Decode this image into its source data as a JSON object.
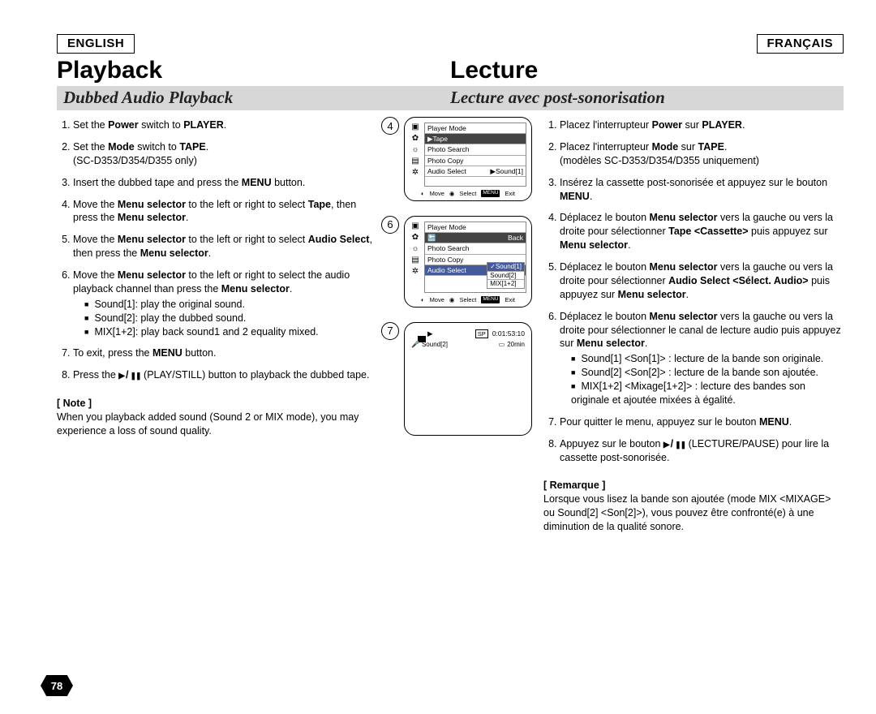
{
  "lang_left": "ENGLISH",
  "lang_right": "FRANÇAIS",
  "title_left": "Playback",
  "title_right": "Lecture",
  "subtitle_left": "Dubbed Audio Playback",
  "subtitle_right": "Lecture avec post-sonorisation",
  "en": {
    "step1": {
      "pre": "Set the ",
      "b1": "Power",
      "mid": " switch to ",
      "b2": "PLAYER",
      "post": "."
    },
    "step2": {
      "pre": "Set the ",
      "b1": "Mode",
      "mid": " switch to ",
      "b2": "TAPE",
      "post": ".",
      "extra": "(SC-D353/D354/D355 only)"
    },
    "step3": {
      "pre": "Insert the dubbed tape and press the ",
      "b1": "MENU",
      "post": " button."
    },
    "step4": {
      "pre": "Move the ",
      "b1": "Menu selector",
      "mid": " to the left or right to select ",
      "b2": "Tape",
      "mid2": ", then press the ",
      "b3": "Menu selector",
      "post": "."
    },
    "step5": {
      "pre": "Move the ",
      "b1": "Menu selector",
      "mid": " to the left or right to select ",
      "b2": "Audio Select",
      "mid2": ", then press the ",
      "b3": "Menu selector",
      "post": "."
    },
    "step6": {
      "pre": "Move the ",
      "b1": "Menu selector",
      "mid": " to the left or right to select the audio playback channel than press the ",
      "b2": "Menu selector",
      "post": "."
    },
    "bul1": "Sound[1]: play the original sound.",
    "bul2": "Sound[2]: play the dubbed sound.",
    "bul3": "MIX[1+2]: play back sound1 and 2 equality mixed.",
    "step7": {
      "pre": "To exit, press the ",
      "b1": "MENU",
      "post": " button."
    },
    "step8": {
      "pre": "Press the ",
      "mid": " (PLAY/STILL) button to playback the dubbed tape."
    },
    "note_h": "[ Note ]",
    "note_body": "When you playback added sound (Sound 2 or MIX mode), you may experience a loss of sound quality."
  },
  "fr": {
    "step1": {
      "pre": "Placez l'interrupteur ",
      "b1": "Power",
      "mid": " sur ",
      "b2": "PLAYER",
      "post": "."
    },
    "step2": {
      "pre": "Placez l'interrupteur ",
      "b1": "Mode",
      "mid": " sur ",
      "b2": "TAPE",
      "post": ".",
      "extra": "(modèles SC-D353/D354/D355 uniquement)"
    },
    "step3": {
      "pre": "Insérez la cassette post-sonorisée et appuyez sur le bouton ",
      "b1": "MENU",
      "post": "."
    },
    "step4": {
      "pre": "Déplacez le bouton ",
      "b1": "Menu selector",
      "mid": " vers la gauche ou vers la droite pour sélectionner ",
      "b2": "Tape <Cassette>",
      "mid2": " puis appuyez sur ",
      "b3": "Menu selector",
      "post": "."
    },
    "step5": {
      "pre": "Déplacez le bouton ",
      "b1": "Menu selector",
      "mid": " vers la gauche ou vers la droite pour sélectionner ",
      "b2": "Audio Select <Sélect. Audio>",
      "mid2": " puis appuyez sur ",
      "b3": "Menu selector",
      "post": "."
    },
    "step6": {
      "pre": "Déplacez le bouton ",
      "b1": "Menu selector",
      "mid": " vers la gauche ou vers la droite pour sélectionner le canal de lecture audio puis appuyez sur ",
      "b2": "Menu selector",
      "post": "."
    },
    "bul1": "Sound[1] <Son[1]> : lecture de la bande son originale.",
    "bul2": "Sound[2] <Son[2]> : lecture de la bande son ajoutée.",
    "bul3": "MIX[1+2] <Mixage[1+2]> : lecture des bandes son originale et ajoutée mixées à égalité.",
    "step7": {
      "pre": "Pour quitter le menu, appuyez sur le bouton ",
      "b1": "MENU",
      "post": "."
    },
    "step8": {
      "pre": "Appuyez sur le bouton ",
      "mid": " (LECTURE/PAUSE) pour lire la cassette post-sonorisée."
    },
    "note_h": "[ Remarque ]",
    "note_body": "Lorsque vous lisez la bande son ajoutée (mode MIX <MIXAGE> ou Sound[2] <Son[2]>), vous pouvez être confronté(e) à une diminution de la qualité sonore."
  },
  "mid": {
    "label4": "4",
    "label6": "6",
    "label7": "7",
    "menu_title": "Player Mode",
    "row_tape": "▶Tape",
    "row_back": "Back",
    "row_photo_search": "Photo Search",
    "row_photo_copy": "Photo Copy",
    "row_audio_select": "Audio Select",
    "val_sound1": "▶Sound[1]",
    "opt_sound1": "✓Sound[1]",
    "opt_sound2": "Sound[2]",
    "opt_mix": "MIX[1+2]",
    "hint_move": "Move",
    "hint_select": "Select",
    "hint_exit_kbd": "MENU",
    "hint_exit": "Exit",
    "ps_play": "▶",
    "ps_sp": "SP",
    "ps_time": "0:01:53:10",
    "ps_label": "Sound[2]",
    "ps_20min": "20min"
  },
  "page_number": "78"
}
